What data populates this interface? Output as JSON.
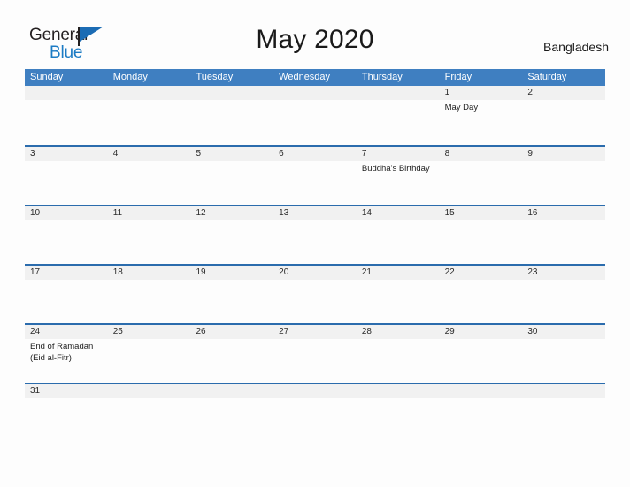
{
  "brand": {
    "name_part1": "General",
    "name_part2": "Blue",
    "flag_icon": "flag-icon"
  },
  "header": {
    "title": "May 2020",
    "location": "Bangladesh"
  },
  "calendar": {
    "month": "May",
    "year": "2020",
    "weekday_headers": [
      "Sunday",
      "Monday",
      "Tuesday",
      "Wednesday",
      "Thursday",
      "Friday",
      "Saturday"
    ],
    "accent_color": "#3f7fc1",
    "rule_color": "#2b6cad",
    "day_strip_color": "#f1f1f1",
    "weeks": [
      {
        "days": [
          {
            "num": "",
            "events": []
          },
          {
            "num": "",
            "events": []
          },
          {
            "num": "",
            "events": []
          },
          {
            "num": "",
            "events": []
          },
          {
            "num": "",
            "events": []
          },
          {
            "num": "1",
            "events": [
              "May Day"
            ]
          },
          {
            "num": "2",
            "events": []
          }
        ]
      },
      {
        "days": [
          {
            "num": "3",
            "events": []
          },
          {
            "num": "4",
            "events": []
          },
          {
            "num": "5",
            "events": []
          },
          {
            "num": "6",
            "events": []
          },
          {
            "num": "7",
            "events": [
              "Buddha's Birthday"
            ]
          },
          {
            "num": "8",
            "events": []
          },
          {
            "num": "9",
            "events": []
          }
        ]
      },
      {
        "days": [
          {
            "num": "10",
            "events": []
          },
          {
            "num": "11",
            "events": []
          },
          {
            "num": "12",
            "events": []
          },
          {
            "num": "13",
            "events": []
          },
          {
            "num": "14",
            "events": []
          },
          {
            "num": "15",
            "events": []
          },
          {
            "num": "16",
            "events": []
          }
        ]
      },
      {
        "days": [
          {
            "num": "17",
            "events": []
          },
          {
            "num": "18",
            "events": []
          },
          {
            "num": "19",
            "events": []
          },
          {
            "num": "20",
            "events": []
          },
          {
            "num": "21",
            "events": []
          },
          {
            "num": "22",
            "events": []
          },
          {
            "num": "23",
            "events": []
          }
        ]
      },
      {
        "days": [
          {
            "num": "24",
            "events": [
              "End of Ramadan",
              "(Eid al-Fitr)"
            ]
          },
          {
            "num": "25",
            "events": []
          },
          {
            "num": "26",
            "events": []
          },
          {
            "num": "27",
            "events": []
          },
          {
            "num": "28",
            "events": []
          },
          {
            "num": "29",
            "events": []
          },
          {
            "num": "30",
            "events": []
          }
        ]
      },
      {
        "days": [
          {
            "num": "31",
            "events": []
          },
          {
            "num": "",
            "events": []
          },
          {
            "num": "",
            "events": []
          },
          {
            "num": "",
            "events": []
          },
          {
            "num": "",
            "events": []
          },
          {
            "num": "",
            "events": []
          },
          {
            "num": "",
            "events": []
          }
        ]
      }
    ]
  }
}
